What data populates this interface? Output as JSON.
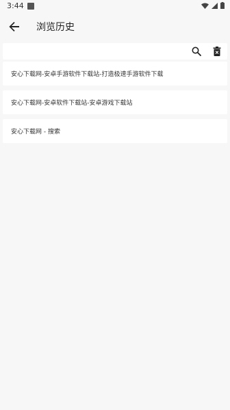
{
  "status_bar": {
    "time": "3:44"
  },
  "app_bar": {
    "title": "浏览历史"
  },
  "search": {
    "value": "",
    "placeholder": ""
  },
  "history": {
    "items": [
      {
        "title": "安心下载网-安卓手游软件下载站-打造极速手游软件下载"
      },
      {
        "title": "安心下载网-安卓软件下载站-安卓游戏下载站"
      },
      {
        "title": "安心下载网 - 搜索"
      }
    ]
  },
  "icons": {
    "back": "arrow-left-icon",
    "search": "search-icon",
    "delete": "trash-icon",
    "wifi": "wifi-icon",
    "signal": "signal-icon",
    "battery": "battery-icon"
  },
  "colors": {
    "background": "#f7f7f7",
    "card": "#ffffff",
    "text": "#222222"
  }
}
